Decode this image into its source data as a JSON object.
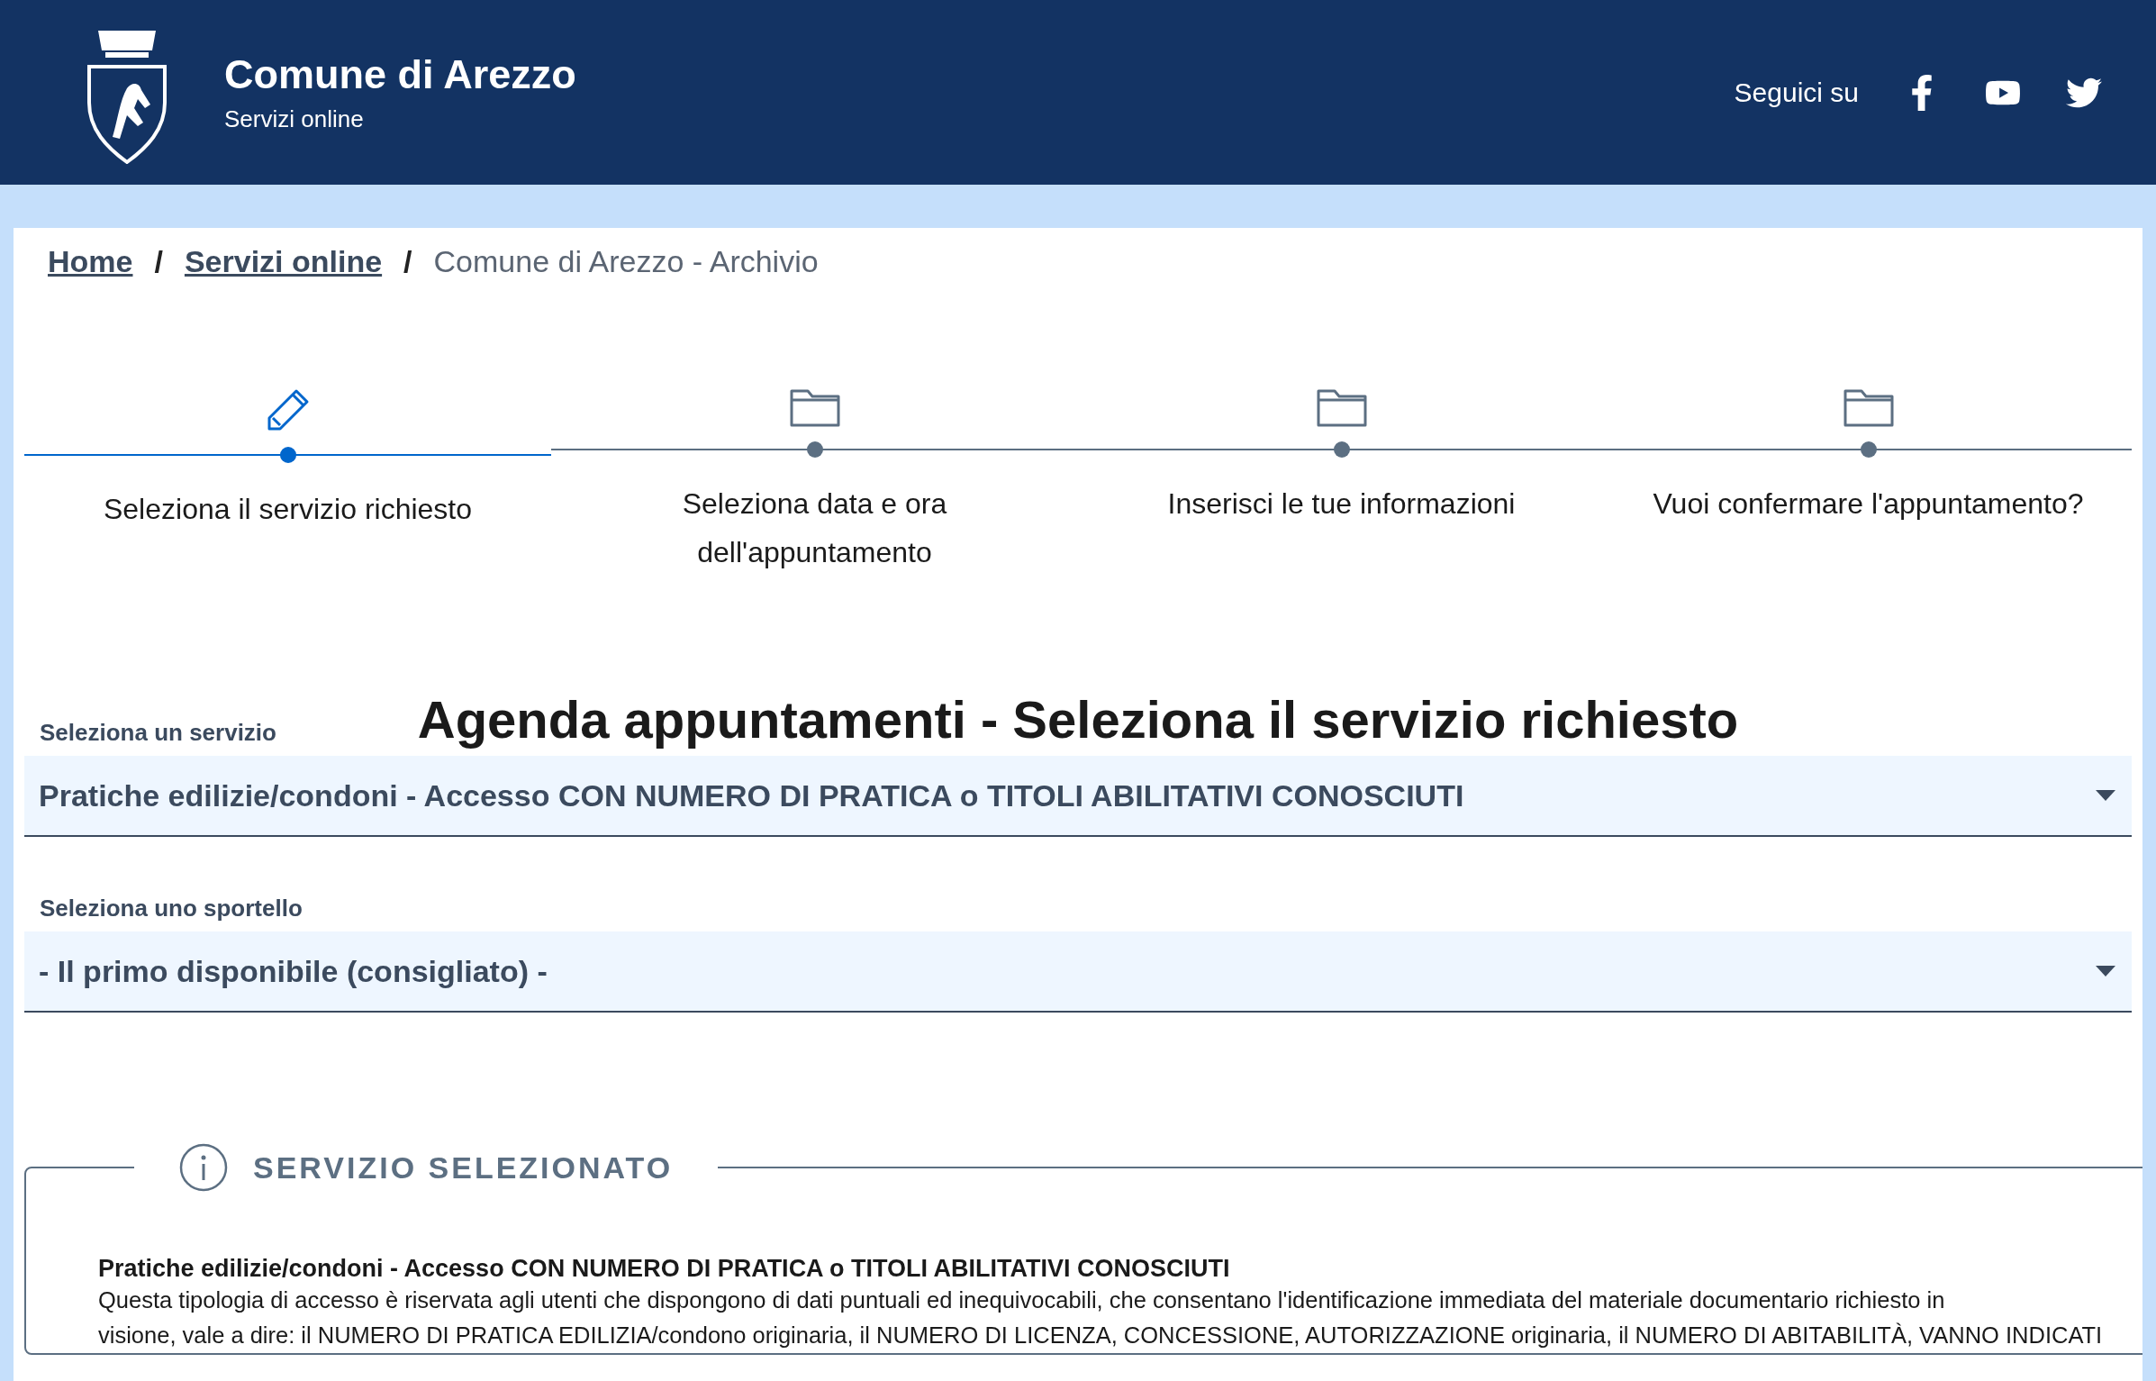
{
  "header": {
    "title": "Comune di Arezzo",
    "subtitle": "Servizi online",
    "follow_label": "Seguici su"
  },
  "breadcrumb": [
    {
      "label": "Home",
      "link": true
    },
    {
      "label": "Servizi online",
      "link": true
    },
    {
      "label": "Comune di Arezzo - Archivio",
      "link": false
    }
  ],
  "breadcrumb_separator": "/",
  "steps": [
    {
      "label": "Seleziona il servizio richiesto",
      "selected": true
    },
    {
      "label": "Seleziona data e ora dell'appuntamento",
      "selected": false
    },
    {
      "label": "Inserisci le tue informazioni",
      "selected": false
    },
    {
      "label": "Vuoi confermare l'appuntamento?",
      "selected": false
    }
  ],
  "title": "Agenda appuntamenti - Seleziona il servizio richiesto",
  "selects": [
    {
      "label": "Seleziona un servizio",
      "value": "Pratiche edilizie/condoni - Accesso CON NUMERO DI PRATICA o TITOLI ABILITATIVI CONOSCIUTI"
    },
    {
      "label": "Seleziona uno sportello",
      "value": "- Il primo disponibile (consigliato) -"
    }
  ],
  "selected_service": {
    "legend": "SERVIZIO SELEZIONATO",
    "name": "Pratiche edilizie/condoni - Accesso CON NUMERO DI PRATICA o TITOLI ABILITATIVI CONOSCIUTI",
    "description": [
      "Questa tipologia di accesso è riservata agli utenti che dispongono di dati puntuali ed inequivocabili, che consentano l'identificazione immediata del materiale documentario richiesto in",
      "visione, vale a dire: il NUMERO DI PRATICA EDILIZIA/condono originaria, il NUMERO DI LICENZA, CONCESSIONE, AUTORIZZAZIONE originaria, il NUMERO DI ABITABILITÀ, VANNO INDICATI"
    ]
  }
}
